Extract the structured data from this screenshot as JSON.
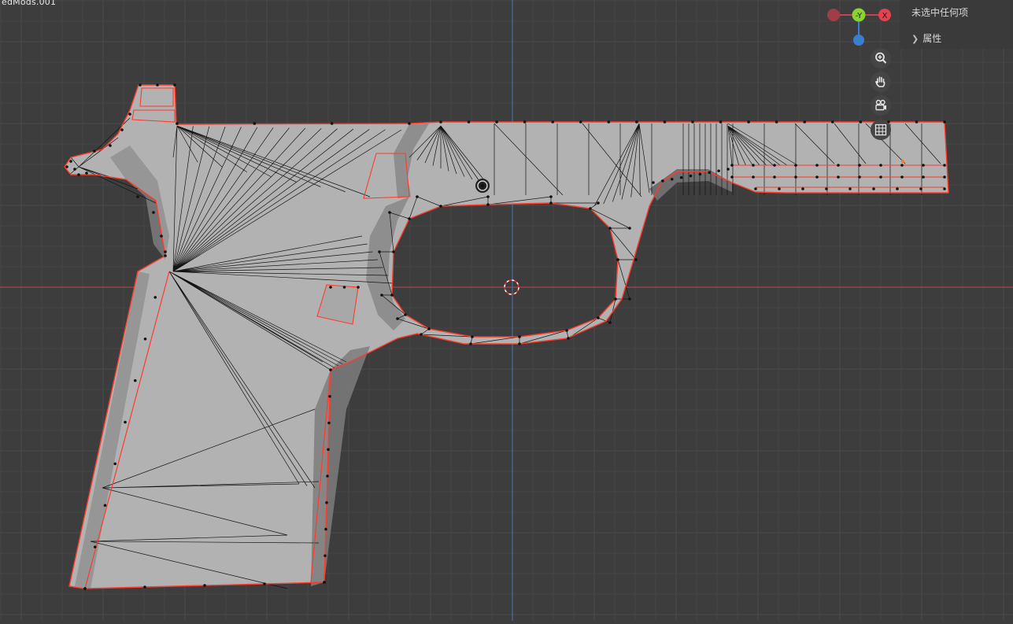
{
  "viewport": {
    "object_name": "edMods.001",
    "colors": {
      "background": "#3d3d3d",
      "grid_minor": "#454545",
      "grid_major": "#4b4b4b",
      "axis_x": "#b94a4a",
      "axis_z": "#4b74b5",
      "mesh_face": "#b2b2b2",
      "mesh_face_shadow": "#7c7c7c",
      "mesh_edge": "#141414",
      "selected_outline": "#ff3b2a"
    }
  },
  "gizmo": {
    "axis_y_label": "-Y",
    "axis_x_label": "X",
    "colors": {
      "x": "#e8404f",
      "y": "#8ad42e",
      "z": "#3b7ed0",
      "neg_x": "#a03d48"
    }
  },
  "nav_tools": [
    {
      "id": "zoom",
      "icon": "zoom-icon"
    },
    {
      "id": "pan",
      "icon": "hand-pan-icon"
    },
    {
      "id": "camera",
      "icon": "camera-view-icon"
    },
    {
      "id": "ortho",
      "icon": "grid-ortho-icon"
    }
  ],
  "outliner": {
    "status_text": "未选中任何项",
    "properties_label": "属性"
  }
}
